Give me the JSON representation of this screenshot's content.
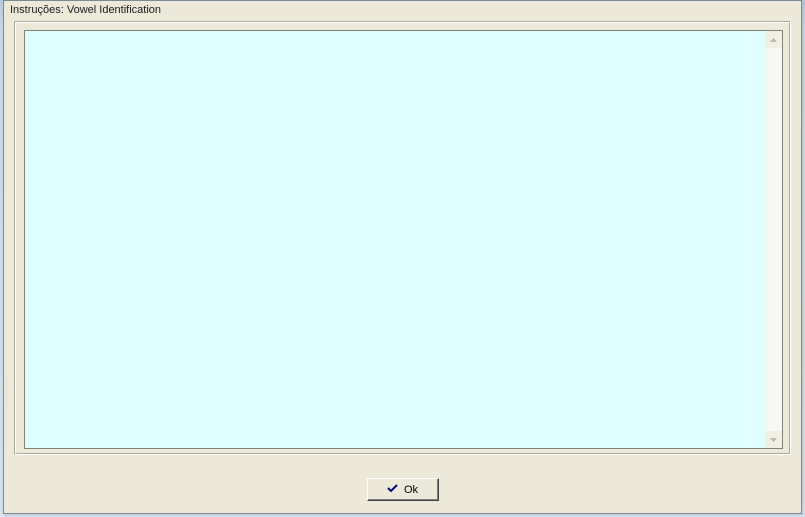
{
  "dialog": {
    "title": "Instruções: Vowel Identification",
    "textarea_value": "",
    "ok_button_label": "Ok"
  }
}
